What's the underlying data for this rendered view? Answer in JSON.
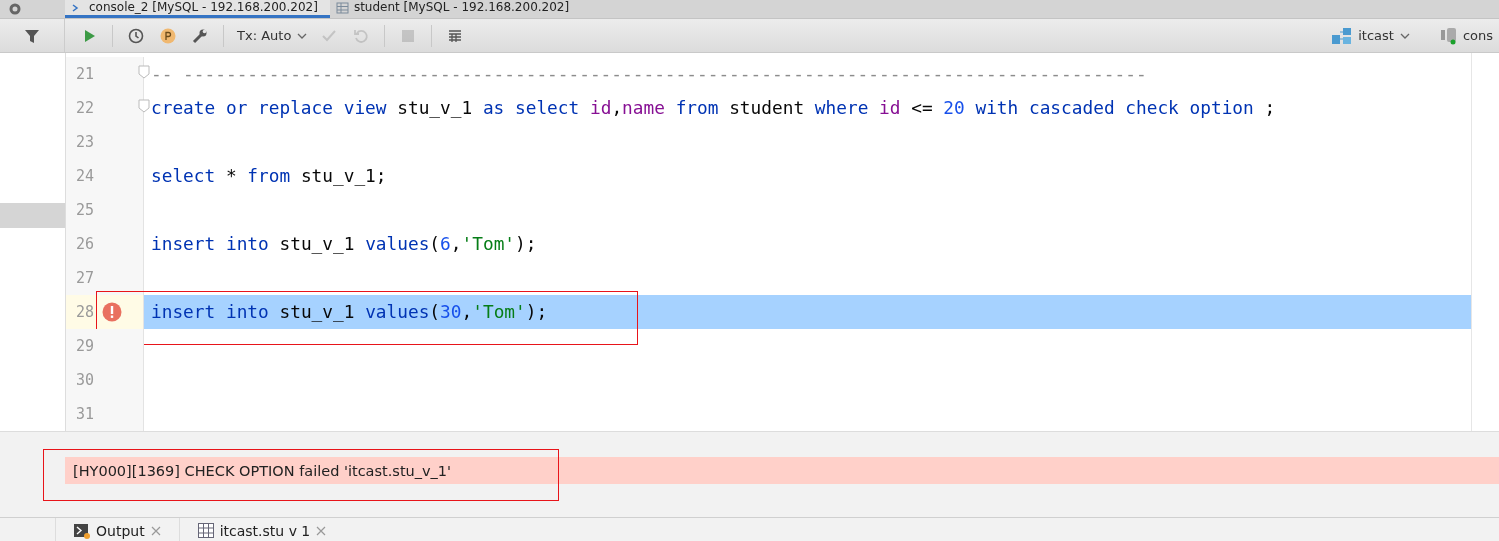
{
  "editor_tabs": [
    {
      "label": "console_2 [MySQL - 192.168.200.202]",
      "selected": true
    },
    {
      "label": "student [MySQL - 192.168.200.202]",
      "selected": false
    }
  ],
  "toolbar": {
    "buttons": [
      {
        "kind": "run",
        "disabled": false
      },
      {
        "kind": "history",
        "disabled": false
      },
      {
        "kind": "profile",
        "disabled": false
      },
      {
        "kind": "settings",
        "disabled": false
      },
      {
        "kind": "tx",
        "label": "Tx: Auto",
        "disabled": false
      },
      {
        "kind": "commit",
        "disabled": true
      },
      {
        "kind": "rollback",
        "disabled": true
      },
      {
        "kind": "stop",
        "disabled": true
      },
      {
        "kind": "table",
        "disabled": false
      }
    ],
    "schema": "itcast",
    "console": "cons"
  },
  "left_panel": {
    "rows": [
      {
        "selected": true
      }
    ]
  },
  "lines": [
    {
      "number": "21",
      "fold": true,
      "tokens": [
        {
          "kind": "comment",
          "text": "-- ------------------------------------------------------------------------------------------"
        }
      ]
    },
    {
      "number": "22",
      "fold": true,
      "tokens": [
        {
          "kind": "keyword",
          "text": "create or replace view "
        },
        {
          "kind": "identifier",
          "text": "stu_v_1 "
        },
        {
          "kind": "keyword",
          "text": "as select "
        },
        {
          "kind": "column",
          "text": "id"
        },
        {
          "kind": "identifier",
          "text": ","
        },
        {
          "kind": "column",
          "text": "name "
        },
        {
          "kind": "keyword",
          "text": "from "
        },
        {
          "kind": "identifier",
          "text": "student "
        },
        {
          "kind": "keyword",
          "text": "where "
        },
        {
          "kind": "column",
          "text": "id "
        },
        {
          "kind": "identifier",
          "text": "<= "
        },
        {
          "kind": "number",
          "text": "20 "
        },
        {
          "kind": "keyword",
          "text": "with cascaded check option "
        },
        {
          "kind": "identifier",
          "text": ";"
        }
      ]
    },
    {
      "number": "23"
    },
    {
      "number": "24",
      "tokens": [
        {
          "kind": "keyword",
          "text": "select "
        },
        {
          "kind": "identifier",
          "text": "* "
        },
        {
          "kind": "keyword",
          "text": "from "
        },
        {
          "kind": "identifier",
          "text": "stu_v_1;"
        }
      ]
    },
    {
      "number": "25"
    },
    {
      "number": "26",
      "tokens": [
        {
          "kind": "keyword",
          "text": "insert into "
        },
        {
          "kind": "identifier",
          "text": "stu_v_1 "
        },
        {
          "kind": "keyword",
          "text": "values"
        },
        {
          "kind": "identifier",
          "text": "("
        },
        {
          "kind": "number",
          "text": "6"
        },
        {
          "kind": "identifier",
          "text": ","
        },
        {
          "kind": "string",
          "text": "'Tom'"
        },
        {
          "kind": "identifier",
          "text": ");"
        }
      ]
    },
    {
      "number": "27"
    },
    {
      "number": "28",
      "selected": true,
      "error": true,
      "framed": true,
      "tokens": [
        {
          "kind": "keyword",
          "text": "insert into "
        },
        {
          "kind": "identifier",
          "text": "stu_v_1 "
        },
        {
          "kind": "keyword",
          "text": "values"
        },
        {
          "kind": "identifier",
          "text": "("
        },
        {
          "kind": "number",
          "text": "30"
        },
        {
          "kind": "identifier",
          "text": ","
        },
        {
          "kind": "string",
          "text": "'Tom'"
        },
        {
          "kind": "identifier",
          "text": ");"
        }
      ]
    },
    {
      "number": "29"
    },
    {
      "number": "30"
    },
    {
      "number": "31"
    }
  ],
  "error": {
    "message": "[HY000][1369] CHECK OPTION failed 'itcast.stu_v_1'",
    "framed": true
  },
  "tool_tabs": [
    {
      "kind": "output",
      "label": "Output"
    },
    {
      "kind": "table",
      "label": "itcast.stu v 1"
    }
  ]
}
